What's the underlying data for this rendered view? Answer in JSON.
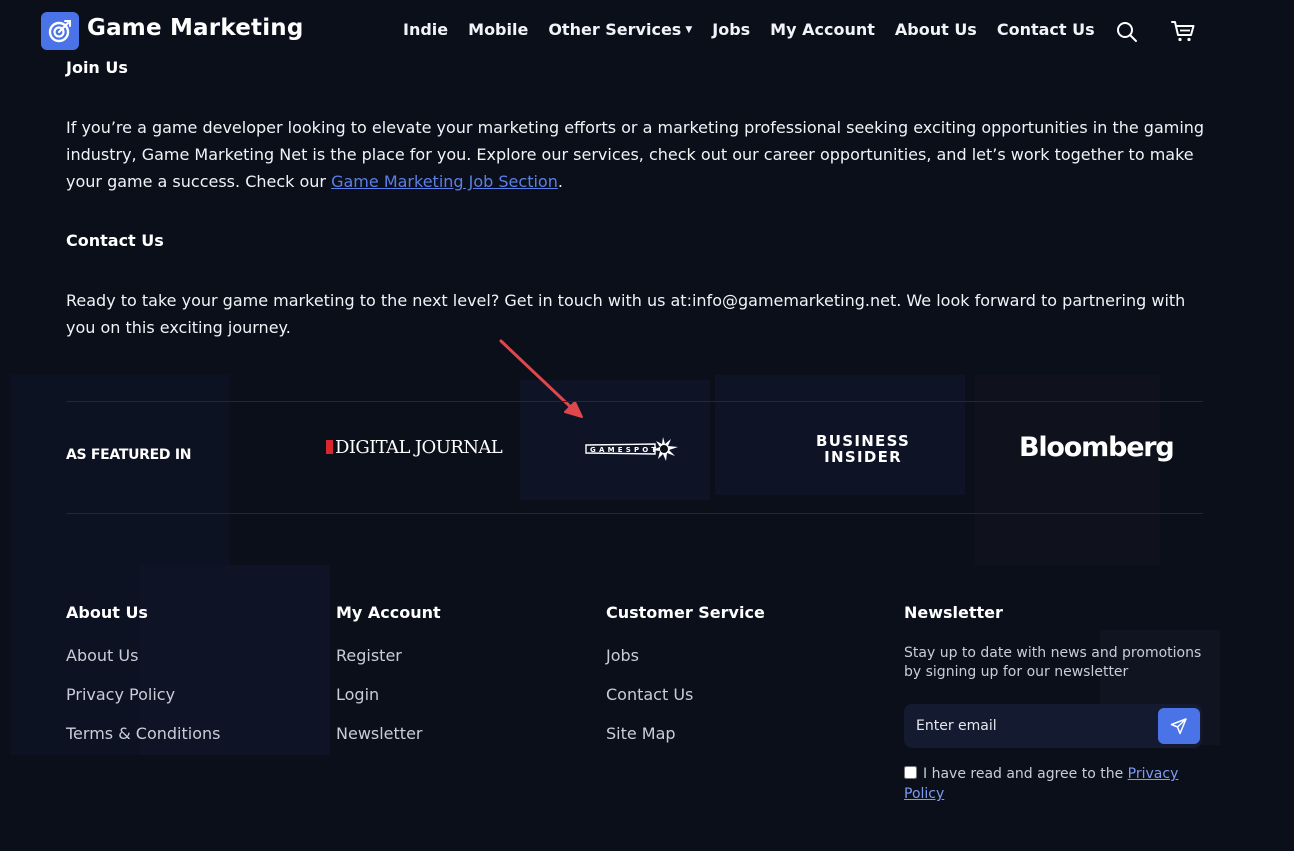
{
  "header": {
    "brand": "Game Marketing",
    "nav": [
      {
        "label": "Indie"
      },
      {
        "label": "Mobile"
      },
      {
        "label": "Other Services",
        "has_dropdown": true
      },
      {
        "label": "Jobs"
      },
      {
        "label": "My Account"
      },
      {
        "label": "About Us"
      },
      {
        "label": "Contact Us"
      }
    ]
  },
  "join": {
    "heading": "Join Us",
    "text": "If you’re a game developer looking to elevate your marketing efforts or a marketing professional seeking exciting opportunities in the gaming industry, Game Marketing Net is the place for you. Explore our services, check out our career opportunities, and let’s work together to make your game a success. Check our ",
    "link": "Game Marketing Job Section",
    "suffix": "."
  },
  "contact": {
    "heading": "Contact Us",
    "text": "Ready to take your game marketing to the next level? Get in touch with us at:info@gamemarketing.net. We look forward to partnering with you on this exciting journey."
  },
  "featured": {
    "label": "AS FEATURED IN",
    "logos": {
      "digital_journal": "DIGITAL JOURNAL",
      "gamespot": "GAMESPOT",
      "business_insider_line1": "BUSINESS",
      "business_insider_line2": "INSIDER",
      "bloomberg": "Bloomberg"
    }
  },
  "footer": {
    "about": {
      "title": "About Us",
      "links": [
        "About Us",
        "Privacy Policy",
        "Terms & Conditions"
      ]
    },
    "account": {
      "title": "My Account",
      "links": [
        "Register",
        "Login",
        "Newsletter"
      ]
    },
    "service": {
      "title": "Customer Service",
      "links": [
        "Jobs",
        "Contact Us",
        "Site Map"
      ]
    },
    "newsletter": {
      "title": "Newsletter",
      "text": "Stay up to date with news and promotions by signing up for our newsletter",
      "placeholder": "Enter email",
      "consent_text": "I have read and agree to the ",
      "consent_link": "Privacy Policy"
    }
  },
  "colors": {
    "background": "#0b0f1a",
    "accent": "#4a73e8",
    "link": "#5b7fe8",
    "arrow": "#e0474c"
  },
  "icons": [
    "logo-icon",
    "search-icon",
    "cart-icon",
    "send-icon",
    "chevron-down-icon",
    "annotation-arrow"
  ]
}
